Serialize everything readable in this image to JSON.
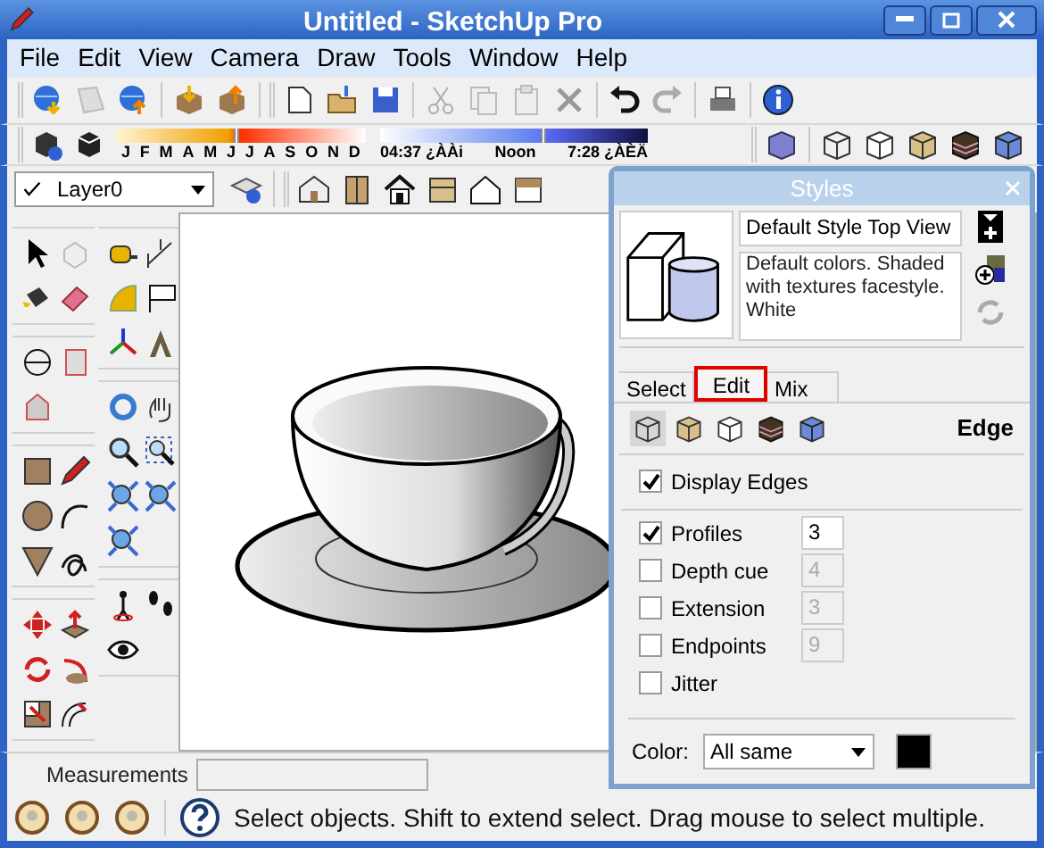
{
  "window": {
    "title": "Untitled - SketchUp Pro"
  },
  "menu": [
    "File",
    "Edit",
    "View",
    "Camera",
    "Draw",
    "Tools",
    "Window",
    "Help"
  ],
  "shadow_settings": {
    "months": [
      "J",
      "F",
      "M",
      "A",
      "M",
      "J",
      "J",
      "A",
      "S",
      "O",
      "N",
      "D"
    ],
    "date_slider": {
      "level": 0.47
    },
    "times": [
      "04:37 ¿ÀÀi",
      "Noon",
      "7:28 ¿ÀÈÄ"
    ],
    "time_slider": {
      "level": 0.6
    }
  },
  "layer_dropdown": {
    "value": "Layer0"
  },
  "styles_panel": {
    "title": "Styles",
    "style_name": "Default Style Top View",
    "description": "Default colors.  Shaded with textures facestyle.  White",
    "tabs": [
      {
        "label": "Select",
        "selected": false
      },
      {
        "label": "Edit",
        "selected": true
      },
      {
        "label": "Mix",
        "selected": false
      }
    ],
    "section_title": "Edge",
    "options": [
      {
        "label": "Display Edges",
        "checked": true
      },
      {
        "label": "Profiles",
        "checked": true,
        "value": "3",
        "disabled": false
      },
      {
        "label": "Depth cue",
        "checked": false,
        "value": "4",
        "disabled": true
      },
      {
        "label": "Extension",
        "checked": false,
        "value": "3",
        "disabled": true
      },
      {
        "label": "Endpoints",
        "checked": false,
        "value": "9",
        "disabled": true
      },
      {
        "label": "Jitter",
        "checked": false
      }
    ],
    "color_setting": {
      "label": "Color:",
      "value": "All same",
      "color": "#000000"
    }
  },
  "measurements": {
    "label": "Measurements"
  },
  "status_bar": {
    "text": "Select objects. Shift to extend select. Drag mouse to select multiple."
  }
}
